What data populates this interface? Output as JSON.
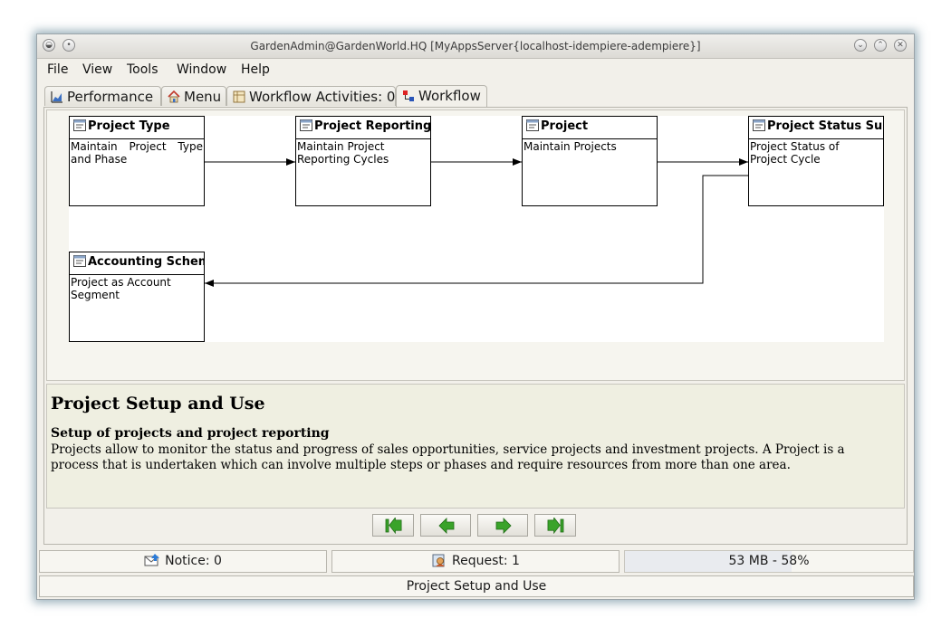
{
  "window": {
    "title": "GardenAdmin@GardenWorld.HQ [MyAppsServer{localhost-idempiere-adempiere}]"
  },
  "menu": [
    {
      "label": "File"
    },
    {
      "label": "View"
    },
    {
      "label": "Tools"
    },
    {
      "label": "Window"
    },
    {
      "label": "Help"
    }
  ],
  "tabs": [
    {
      "label": "Performance",
      "icon": "chart-icon"
    },
    {
      "label": "Menu",
      "icon": "home-icon"
    },
    {
      "label": "Workflow Activities: 0",
      "icon": "activities-icon"
    },
    {
      "label": "Workflow",
      "icon": "workflow-icon",
      "active": true
    }
  ],
  "workflow": {
    "nodes": [
      {
        "title": "Project Type",
        "desc": "Maintain Project Type and Phase"
      },
      {
        "title": "Project Reporting",
        "desc": "Maintain Project Reporting Cycles"
      },
      {
        "title": "Project",
        "desc": "Maintain Projects"
      },
      {
        "title": "Project Status Summary",
        "desc": "Project Status of Project Cycle"
      },
      {
        "title": "Accounting Schema",
        "desc": "Project as Account Segment"
      }
    ]
  },
  "help": {
    "title": "Project Setup and Use",
    "subtitle": "Setup of projects and project reporting",
    "body": "Projects allow to monitor the status and progress of sales opportunities, service projects and investment projects. A Project is a process that is undertaken which can involve multiple steps or phases and require resources from more than one area."
  },
  "navigation": {
    "first": "first-icon",
    "previous": "previous-icon",
    "next": "next-icon",
    "last": "last-icon"
  },
  "status": {
    "notice": "Notice: 0",
    "request": "Request: 1",
    "memory": "53 MB - 58%",
    "memory_fraction": 0.58,
    "footer": "Project Setup and Use"
  },
  "colors": {
    "help_bg": "#efefe1",
    "nav_arrow": "#3aa32a",
    "window_shadow": "#4d8fb0"
  }
}
